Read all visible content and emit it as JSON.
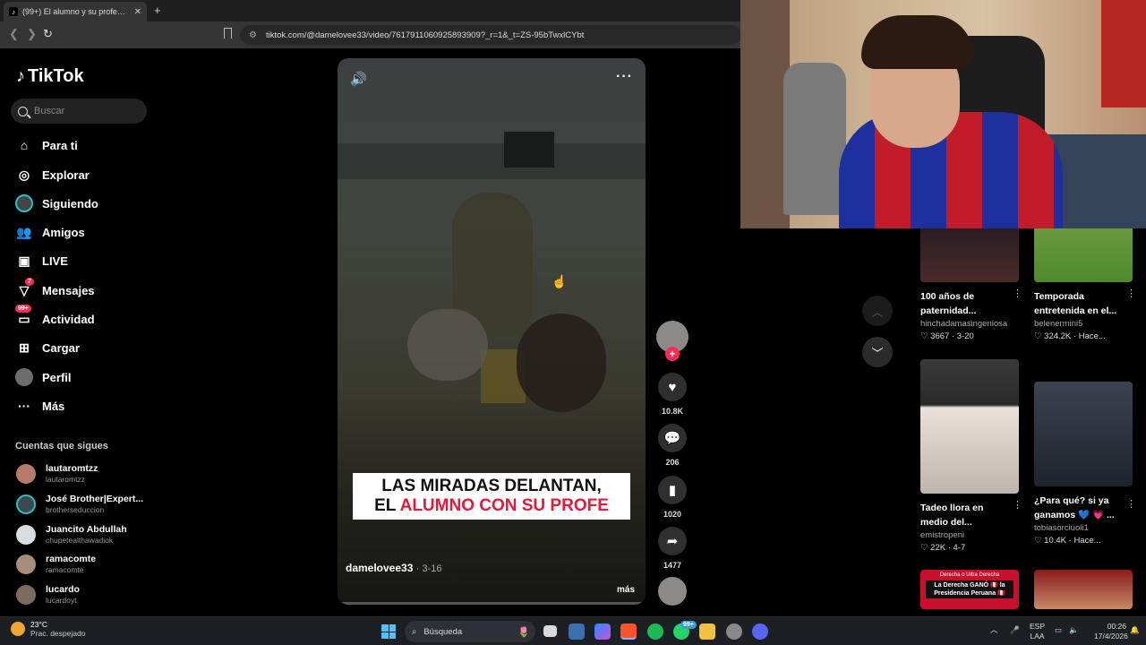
{
  "browser": {
    "tab_title": "(99+) El alumno y su profesor: y...",
    "new_tab": "+",
    "url": "tiktok.com/@damelovee33/video/7617911060925893909?_r=1&_t=ZS-95bTwxlCYbt"
  },
  "sidebar": {
    "logo": "TikTok",
    "search_placeholder": "Buscar",
    "items": [
      {
        "label": "Para ti",
        "icon": "home-icon"
      },
      {
        "label": "Explorar",
        "icon": "compass-icon"
      },
      {
        "label": "Siguiendo",
        "icon": "following-avatar-icon"
      },
      {
        "label": "Amigos",
        "icon": "friends-icon"
      },
      {
        "label": "LIVE",
        "icon": "live-icon"
      },
      {
        "label": "Mensajes",
        "icon": "messages-icon",
        "badge": "7"
      },
      {
        "label": "Actividad",
        "icon": "activity-icon",
        "badge": "99+"
      },
      {
        "label": "Cargar",
        "icon": "upload-icon"
      },
      {
        "label": "Perfil",
        "icon": "profile-icon"
      },
      {
        "label": "Más",
        "icon": "more-icon"
      }
    ],
    "following_header": "Cuentas que sigues",
    "following": [
      {
        "name": "lautaromtzz",
        "handle": "lautaromtzz"
      },
      {
        "name": "José Brother|Expert...",
        "handle": "brotherseduccion"
      },
      {
        "name": "Juancito Abdullah",
        "handle": "chupetealthawadiok"
      },
      {
        "name": "ramacomte",
        "handle": "ramacomte"
      },
      {
        "name": "lucardo",
        "handle": "lucardoyt"
      }
    ]
  },
  "video": {
    "caption_line1": "LAS MIRADAS DELANTAN,",
    "caption_line2_plain": "EL ",
    "caption_line2_red": "ALUMNO CON SU PROFE",
    "author": "damelovee33",
    "date": "3-16",
    "more": "más"
  },
  "actions": {
    "likes": "10.8K",
    "comments": "206",
    "saves": "1020",
    "shares": "1477"
  },
  "recommended": [
    {
      "title1": "100 años de",
      "title2": "paternidad...",
      "author": "hinchadamasingeniosa",
      "likes": "3667",
      "date": "3-20"
    },
    {
      "title1": "Temporada",
      "title2": "entretenida en el...",
      "author": "belenermini5",
      "likes": "324.2K",
      "date": "Hace..."
    },
    {
      "title1": "Tadeo llora en",
      "title2": "medio del...",
      "author": "emistropeni",
      "likes": "22K",
      "date": "4-7"
    },
    {
      "title1": "¿Para qué? si ya",
      "title2": "ganamos 💙 💗 ...",
      "author": "tobiasorciuoli1",
      "likes": "10.4K",
      "date": "Hace..."
    }
  ],
  "thumb_text": {
    "news_top": "Derecha o Ultra Derecha",
    "news_main": "La Derecha GANÓ 🇵🇪 la Presidencia Peruana 🇵🇪"
  },
  "taskbar": {
    "temp": "23°C",
    "weather": "Prac. despejado",
    "search": "Búsqueda",
    "lang1": "ESP",
    "lang2": "LAA",
    "time": "00:26",
    "date": "17/4/2026",
    "whatsapp_badge": "99+"
  },
  "colors": {
    "accent": "#fe2c55",
    "caption_red": "#e21b3c"
  }
}
